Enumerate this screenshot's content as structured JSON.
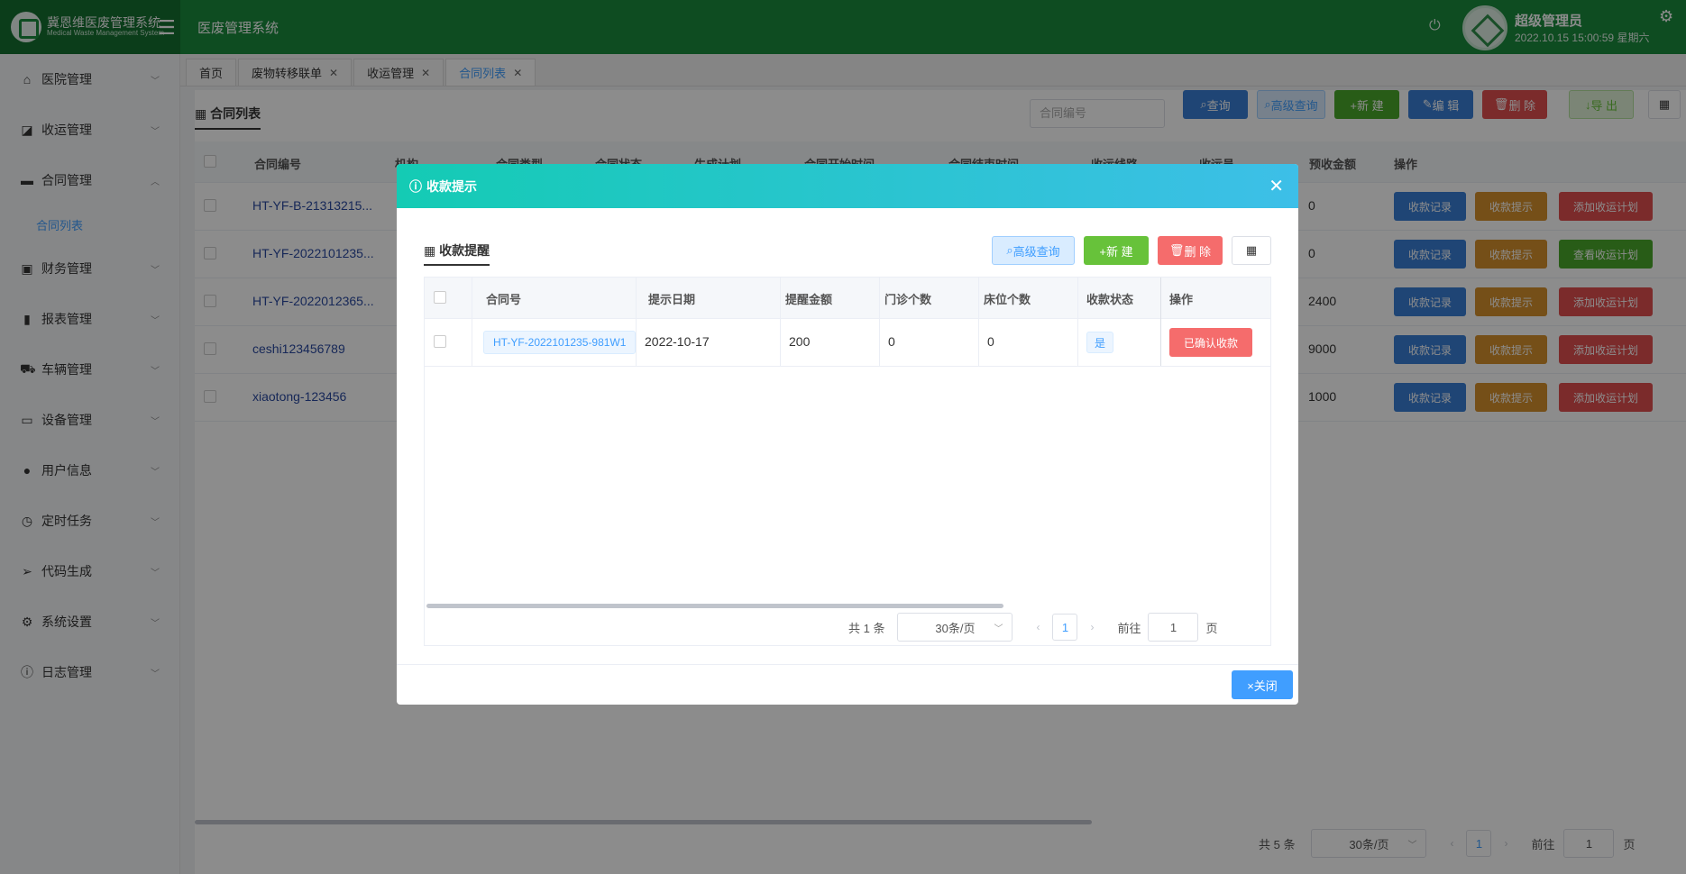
{
  "header": {
    "logo_text": "冀恩维医废管理系统",
    "logo_sub": "Medical Waste Management System",
    "system_title": "医废管理系统",
    "user_name": "超级管理员",
    "datetime": "2022.10.15 15:00:59 星期六"
  },
  "sidebar": {
    "items": [
      {
        "label": "医院管理",
        "icon": "home-icon"
      },
      {
        "label": "收运管理",
        "icon": "chart-icon"
      },
      {
        "label": "合同管理",
        "icon": "briefcase-icon"
      },
      {
        "label": "财务管理",
        "icon": "wallet-icon"
      },
      {
        "label": "报表管理",
        "icon": "bar-chart-icon"
      },
      {
        "label": "车辆管理",
        "icon": "truck-icon"
      },
      {
        "label": "设备管理",
        "icon": "monitor-icon"
      },
      {
        "label": "用户信息",
        "icon": "user-icon"
      },
      {
        "label": "定时任务",
        "icon": "clock-icon"
      },
      {
        "label": "代码生成",
        "icon": "send-icon"
      },
      {
        "label": "系统设置",
        "icon": "gear-icon"
      },
      {
        "label": "日志管理",
        "icon": "info-icon"
      }
    ],
    "sub_item": "合同列表"
  },
  "tabs": [
    {
      "label": "首页",
      "closable": false
    },
    {
      "label": "废物转移联单",
      "closable": true
    },
    {
      "label": "收运管理",
      "closable": true
    },
    {
      "label": "合同列表",
      "closable": true,
      "active": true
    }
  ],
  "main": {
    "title": "合同列表",
    "search_placeholder": "合同编号",
    "buttons": {
      "query": "查询",
      "advanced": "高级查询",
      "new": "+新 建",
      "edit": "编 辑",
      "delete": "删 除",
      "export": "导 出"
    },
    "columns": [
      "合同编号",
      "机构",
      "合同类型",
      "合同状态",
      "生成计划",
      "合同开始时间",
      "合同结束时间",
      "收运线路",
      "收运员",
      "预收金额",
      "操作"
    ],
    "rows": [
      {
        "code": "HT-YF-B-21313215...",
        "amount": "0",
        "action3": "添加收运计划"
      },
      {
        "code": "HT-YF-2022101235...",
        "amount": "0",
        "action3": "查看收运计划"
      },
      {
        "code": "HT-YF-2022012365...",
        "amount": "2400",
        "action3": "添加收运计划"
      },
      {
        "code": "ceshi123456789",
        "amount": "9000",
        "action3": "添加收运计划"
      },
      {
        "code": "xiaotong-123456",
        "amount": "1000",
        "action3": "添加收运计划"
      }
    ],
    "row_action1": "收款记录",
    "row_action2": "收款提示",
    "pager": {
      "total": "共 5 条",
      "page_size": "30条/页",
      "current": "1",
      "goto_label": "前往",
      "goto_value": "1",
      "page_suffix": "页"
    }
  },
  "dialog": {
    "title": "收款提示",
    "sub_title": "收款提醒",
    "buttons": {
      "advanced": "高级查询",
      "new": "+新 建",
      "delete": "删 除"
    },
    "columns": [
      "合同号",
      "提示日期",
      "提醒金额",
      "门诊个数",
      "床位个数",
      "收款状态",
      "操作"
    ],
    "row": {
      "code": "HT-YF-2022101235-981W1",
      "date": "2022-10-17",
      "amount": "200",
      "clinics": "0",
      "beds": "0",
      "status": "是",
      "action": "已确认收款"
    },
    "pager": {
      "total": "共 1 条",
      "page_size": "30条/页",
      "current": "1",
      "goto_label": "前往",
      "goto_value": "1",
      "page_suffix": "页"
    },
    "close_label": "×关闭"
  },
  "colors": {
    "header_green": "#1a8a3c",
    "primary_blue": "#409eff",
    "danger_red": "#f56c6c",
    "warning_orange": "#d6902d"
  }
}
